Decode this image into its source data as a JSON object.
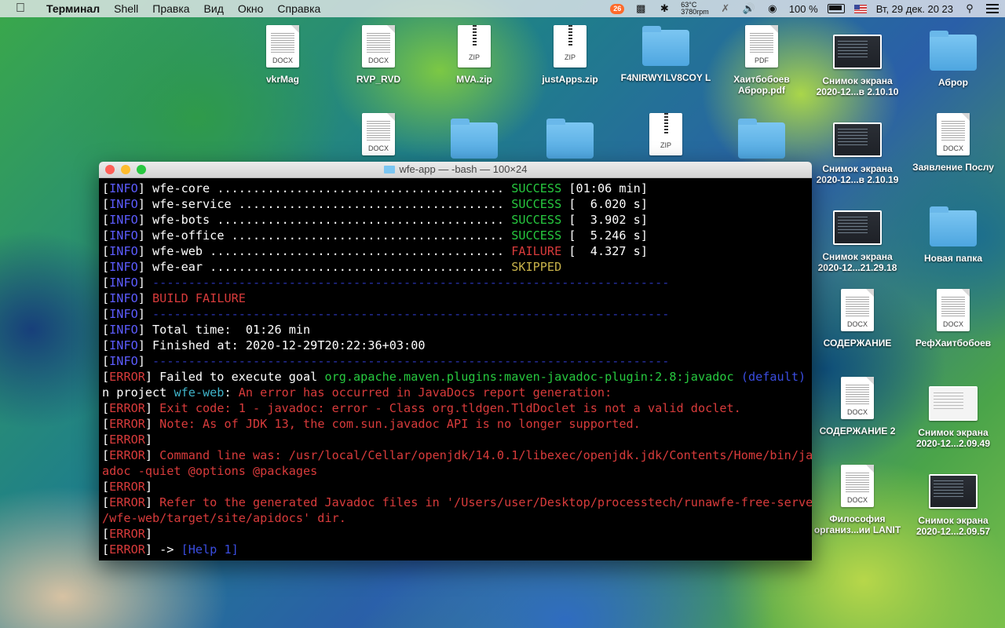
{
  "menubar": {
    "apple_icon": "apple-icon",
    "items": [
      "Терминал",
      "Shell",
      "Правка",
      "Вид",
      "Окно",
      "Справка"
    ],
    "status": {
      "badge_count": "26",
      "temp_line1": "63°C",
      "temp_line2": "3780rpm",
      "battery_percent": "100 %",
      "clock": "Вт, 29 дек.  20 23"
    }
  },
  "desktop": {
    "icons": [
      {
        "label": "vkrMag",
        "kind": "docx",
        "ext": "DOCX"
      },
      {
        "label": "RVP_RVD",
        "kind": "docx",
        "ext": "DOCX"
      },
      {
        "label": "MVA.zip",
        "kind": "zip",
        "ext": "ZIP"
      },
      {
        "label": "justApps.zip",
        "kind": "zip",
        "ext": "ZIP"
      },
      {
        "label": "F4NIRWYILV8COY L",
        "kind": "folder"
      },
      {
        "label": "Хаитбобоев Аброр.pdf",
        "kind": "pdf",
        "ext": "PDF"
      },
      {
        "label": "Снимок экрана 2020-12...в 2.10.10",
        "kind": "shot"
      },
      {
        "label": "Аброр",
        "kind": "folder"
      },
      {
        "label": "",
        "kind": "docx",
        "ext": "DOCX"
      },
      {
        "label": "",
        "kind": "folder"
      },
      {
        "label": "",
        "kind": "folder"
      },
      {
        "label": "",
        "kind": "zip",
        "ext": "ZIP"
      },
      {
        "label": "",
        "kind": "folder"
      },
      {
        "label": "Снимок экрана 2020-12...в 2.10.19",
        "kind": "shot"
      },
      {
        "label": "Заявление Послу",
        "kind": "docx",
        "ext": "DOCX"
      },
      {
        "label": "Снимок экрана 2020-12...21.29.18",
        "kind": "shot"
      },
      {
        "label": "Новая папка",
        "kind": "folder"
      },
      {
        "label": "СОДЕРЖАНИЕ",
        "kind": "docx",
        "ext": "DOCX"
      },
      {
        "label": "РефХаитбобоев",
        "kind": "docx",
        "ext": "DOCX"
      },
      {
        "label": "СОДЕРЖАНИЕ 2",
        "kind": "docx",
        "ext": "DOCX"
      },
      {
        "label": "Снимок экрана 2020-12...2.09.49",
        "kind": "shot-light"
      },
      {
        "label": "Философия организ...ии LANIT",
        "kind": "docx",
        "ext": "DOCX"
      },
      {
        "label": "Снимок экрана 2020-12...2.09.57",
        "kind": "shot"
      }
    ]
  },
  "terminal": {
    "title": "wfe-app — -bash — 100×24",
    "lines": [
      [
        [
          "[",
          "b"
        ],
        [
          "INFO",
          "tag-info"
        ],
        [
          "] wfe-core ........................................ ",
          "b"
        ],
        [
          "SUCCESS",
          "ok"
        ],
        [
          " [01:06 min]",
          "b"
        ]
      ],
      [
        [
          "[",
          "b"
        ],
        [
          "INFO",
          "tag-info"
        ],
        [
          "] wfe-service ..................................... ",
          "b"
        ],
        [
          "SUCCESS",
          "ok"
        ],
        [
          " [  6.020 s]",
          "b"
        ]
      ],
      [
        [
          "[",
          "b"
        ],
        [
          "INFO",
          "tag-info"
        ],
        [
          "] wfe-bots ........................................ ",
          "b"
        ],
        [
          "SUCCESS",
          "ok"
        ],
        [
          " [  3.902 s]",
          "b"
        ]
      ],
      [
        [
          "[",
          "b"
        ],
        [
          "INFO",
          "tag-info"
        ],
        [
          "] wfe-office ...................................... ",
          "b"
        ],
        [
          "SUCCESS",
          "ok"
        ],
        [
          " [  5.246 s]",
          "b"
        ]
      ],
      [
        [
          "[",
          "b"
        ],
        [
          "INFO",
          "tag-info"
        ],
        [
          "] wfe-web ......................................... ",
          "b"
        ],
        [
          "FAILURE",
          "fail"
        ],
        [
          " [  4.327 s]",
          "b"
        ]
      ],
      [
        [
          "[",
          "b"
        ],
        [
          "INFO",
          "tag-info"
        ],
        [
          "] wfe-ear ......................................... ",
          "b"
        ],
        [
          "SKIPPED",
          "skip"
        ]
      ],
      [
        [
          "[",
          "b"
        ],
        [
          "INFO",
          "tag-info"
        ],
        [
          "] ",
          "b"
        ],
        [
          "------------------------------------------------------------------------",
          "sep"
        ]
      ],
      [
        [
          "[",
          "b"
        ],
        [
          "INFO",
          "tag-info"
        ],
        [
          "] ",
          "b"
        ],
        [
          "BUILD FAILURE",
          "fail"
        ]
      ],
      [
        [
          "[",
          "b"
        ],
        [
          "INFO",
          "tag-info"
        ],
        [
          "] ",
          "b"
        ],
        [
          "------------------------------------------------------------------------",
          "sep"
        ]
      ],
      [
        [
          "[",
          "b"
        ],
        [
          "INFO",
          "tag-info"
        ],
        [
          "] Total time:  01:26 min",
          "b"
        ]
      ],
      [
        [
          "[",
          "b"
        ],
        [
          "INFO",
          "tag-info"
        ],
        [
          "] Finished at: 2020-12-29T20:22:36+03:00",
          "b"
        ]
      ],
      [
        [
          "[",
          "b"
        ],
        [
          "INFO",
          "tag-info"
        ],
        [
          "] ",
          "b"
        ],
        [
          "------------------------------------------------------------------------",
          "sep"
        ]
      ],
      [
        [
          "[",
          "b"
        ],
        [
          "ERROR",
          "tag-error"
        ],
        [
          "] Failed to execute goal ",
          "b"
        ],
        [
          "org.apache.maven.plugins:maven-javadoc-plugin:2.8:javadoc",
          "green"
        ],
        [
          " ",
          "b"
        ],
        [
          "(default)",
          "blue"
        ],
        [
          " o",
          "b"
        ]
      ],
      [
        [
          "n project ",
          "b"
        ],
        [
          "wfe-web",
          "cyan"
        ],
        [
          ": ",
          "b"
        ],
        [
          "An error has occurred in JavaDocs report generation:",
          "err"
        ]
      ],
      [
        [
          "[",
          "b"
        ],
        [
          "ERROR",
          "tag-error"
        ],
        [
          "] ",
          "b"
        ],
        [
          "Exit code: 1 - javadoc: error - Class org.tldgen.TldDoclet is not a valid doclet.",
          "err"
        ]
      ],
      [
        [
          "[",
          "b"
        ],
        [
          "ERROR",
          "tag-error"
        ],
        [
          "] ",
          "b"
        ],
        [
          "Note: As of JDK 13, the com.sun.javadoc API is no longer supported.",
          "err"
        ]
      ],
      [
        [
          "[",
          "b"
        ],
        [
          "ERROR",
          "tag-error"
        ],
        [
          "]",
          "b"
        ]
      ],
      [
        [
          "[",
          "b"
        ],
        [
          "ERROR",
          "tag-error"
        ],
        [
          "] ",
          "b"
        ],
        [
          "Command line was: /usr/local/Cellar/openjdk/14.0.1/libexec/openjdk.jdk/Contents/Home/bin/jav",
          "err"
        ]
      ],
      [
        [
          "adoc -quiet @options @packages",
          "err"
        ]
      ],
      [
        [
          "[",
          "b"
        ],
        [
          "ERROR",
          "tag-error"
        ],
        [
          "]",
          "b"
        ]
      ],
      [
        [
          "[",
          "b"
        ],
        [
          "ERROR",
          "tag-error"
        ],
        [
          "] ",
          "b"
        ],
        [
          "Refer to the generated Javadoc files in '/Users/user/Desktop/processtech/runawfe-free-server",
          "err"
        ]
      ],
      [
        [
          "/wfe-web/target/site/apidocs' dir.",
          "err"
        ]
      ],
      [
        [
          "[",
          "b"
        ],
        [
          "ERROR",
          "tag-error"
        ],
        [
          "]",
          "b"
        ]
      ],
      [
        [
          "[",
          "b"
        ],
        [
          "ERROR",
          "tag-error"
        ],
        [
          "] -> ",
          "b"
        ],
        [
          "[Help 1]",
          "blue"
        ]
      ]
    ]
  }
}
